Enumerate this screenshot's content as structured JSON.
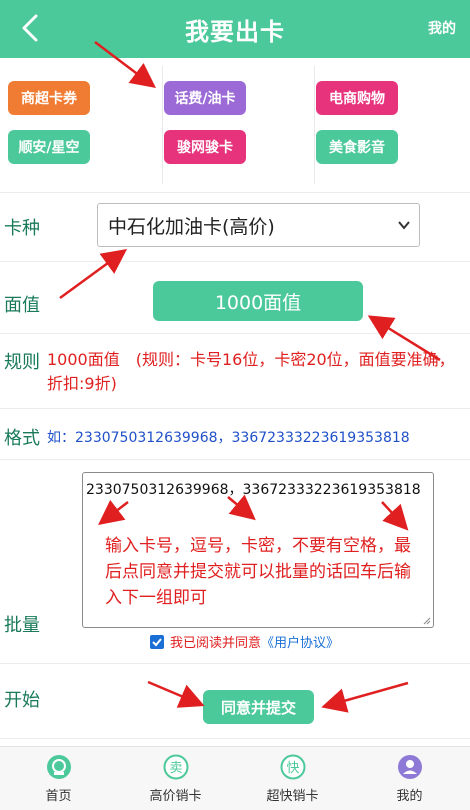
{
  "header": {
    "title": "我要出卡",
    "mine": "我的",
    "back_icon": "chevron-left-icon"
  },
  "categories": [
    {
      "label": "商超卡券",
      "color": "#f07b32"
    },
    {
      "label": "话费/油卡",
      "color": "#9b6ad6"
    },
    {
      "label": "电商购物",
      "color": "#e6337c"
    },
    {
      "label": "顺安/星空",
      "color": "#4cc99a"
    },
    {
      "label": "骏网骏卡",
      "color": "#e6337c"
    },
    {
      "label": "美食影音",
      "color": "#4cc99a"
    }
  ],
  "form": {
    "card_type_label": "卡种",
    "card_type_value": "中石化加油卡(高价)",
    "face_label": "面值",
    "face_value": "1000面值",
    "rule_label": "规则",
    "rule_text": "1000面值　(规则：卡号16位，卡密20位，面值要准确，折扣:9折)",
    "format_label": "格式",
    "format_text": "如：2330750312639968，33672333223619353818",
    "batch_label": "批量",
    "batch_value": "2330750312639968，33672333223619353818",
    "batch_hint": "输入卡号，逗号，卡密，不要有空格，最后点同意并提交就可以批量的话回车后输入下一组即可",
    "agree_checked": true,
    "agree_text": "我已阅读并同意",
    "agree_link": "《用户协议》",
    "start_label": "开始",
    "submit_label": "同意并提交"
  },
  "nav": [
    {
      "label": "首页",
      "icon": "home-icon",
      "color": "#4cc99a"
    },
    {
      "label": "高价销卡",
      "icon": "sell-icon",
      "color": "#4cc99a"
    },
    {
      "label": "超快销卡",
      "icon": "fast-icon",
      "color": "#4cc99a"
    },
    {
      "label": "我的",
      "icon": "profile-icon",
      "color": "#8e7ad6"
    }
  ]
}
